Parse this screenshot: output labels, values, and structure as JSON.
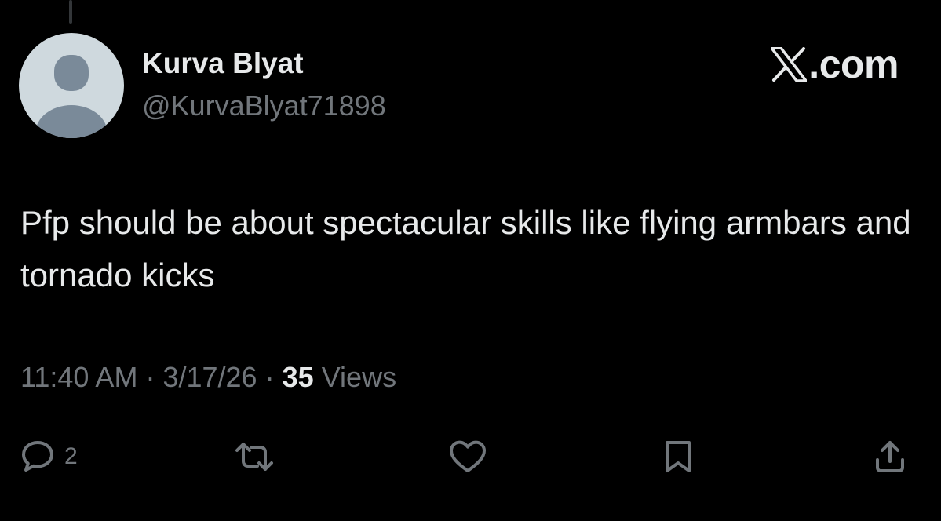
{
  "author": {
    "display_name": "Kurva Blyat",
    "handle": "@KurvaBlyat71898",
    "avatar": "default-avatar-placeholder"
  },
  "brand": {
    "logo_icon": "x-logo-icon",
    "text": ".com"
  },
  "tweet": {
    "text": "Pfp should be about spectacular skills like flying armbars and tornado kicks"
  },
  "meta": {
    "time": "11:40 AM",
    "separator": "·",
    "date": "3/17/26",
    "views_count": "35",
    "views_label": "Views"
  },
  "actions": {
    "reply": {
      "icon": "reply-icon",
      "count": "2"
    },
    "repost": {
      "icon": "repost-icon"
    },
    "like": {
      "icon": "heart-icon"
    },
    "bookmark": {
      "icon": "bookmark-icon"
    },
    "share": {
      "icon": "share-icon"
    }
  },
  "colors": {
    "background": "#000000",
    "primary_text": "#e7e9ea",
    "secondary_text": "#71767b",
    "avatar_bg": "#cfd9de",
    "avatar_figure": "#7a8a99",
    "thread_line": "#333639"
  }
}
